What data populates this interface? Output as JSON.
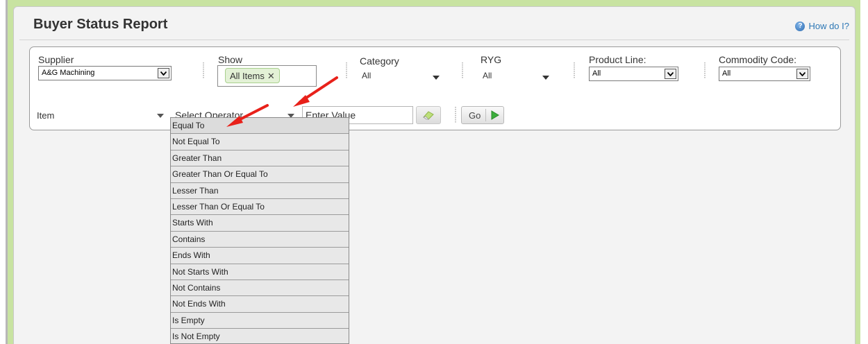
{
  "header": {
    "title": "Buyer Status Report",
    "help_label": "How do I?"
  },
  "filters": {
    "supplier": {
      "label": "Supplier",
      "value": "A&G Machining"
    },
    "show": {
      "label": "Show",
      "chip": "All Items",
      "chip_remove": "✕"
    },
    "category": {
      "label": "Category",
      "value": "All"
    },
    "ryg": {
      "label": "RYG",
      "value": "All"
    },
    "product_line": {
      "label": "Product Line:",
      "value": "All"
    },
    "commodity_code": {
      "label": "Commodity Code:",
      "value": "All"
    }
  },
  "search_row": {
    "field": "Item",
    "operator_placeholder": "Select Operator",
    "value_placeholder": "Enter Value",
    "go_label": "Go"
  },
  "operator_options": [
    "Equal To",
    "Not Equal To",
    "Greater Than",
    "Greater Than Or Equal To",
    "Lesser Than",
    "Lesser Than Or Equal To",
    "Starts With",
    "Contains",
    "Ends With",
    "Not Starts With",
    "Not Contains",
    "Not Ends With",
    "Is Empty",
    "Is Not Empty"
  ],
  "colors": {
    "frame_green": "#c8e3a1",
    "link_blue": "#2d77b5",
    "annotation_red": "#e8211a",
    "go_green": "#3cae3c"
  },
  "icons": [
    "help-icon",
    "chevron-down-icon",
    "eraser-icon",
    "play-icon",
    "arrow-annotation"
  ]
}
